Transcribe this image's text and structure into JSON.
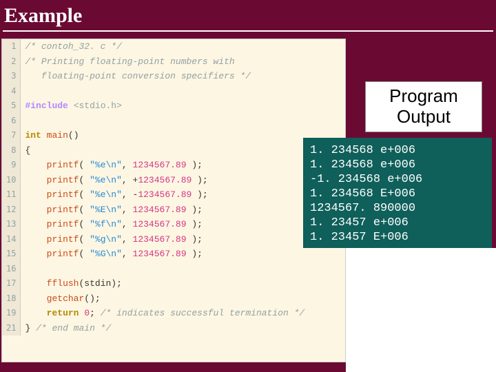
{
  "title": "Example",
  "code": {
    "lines": [
      {
        "n": "1",
        "html": "<span class='cmt'>/* contoh_32. c */</span>"
      },
      {
        "n": "2",
        "html": "<span class='cmt'>/* Printing floating-point numbers with</span>"
      },
      {
        "n": "3",
        "html": "   <span class='cmt'>floating-point conversion specifiers */</span>"
      },
      {
        "n": "4",
        "html": ""
      },
      {
        "n": "5",
        "html": "<span class='pp'>#include</span> <span class='op'>&lt;stdio.h&gt;</span>"
      },
      {
        "n": "6",
        "html": ""
      },
      {
        "n": "7",
        "html": "<span class='kw'>int</span> <span class='fn'>main</span>()"
      },
      {
        "n": "8",
        "html": "{"
      },
      {
        "n": "9",
        "html": "    <span class='fn'>printf</span>( <span class='str'>\"%e\\n\"</span>, <span class='num'>1234567.89</span> );"
      },
      {
        "n": "10",
        "html": "    <span class='fn'>printf</span>( <span class='str'>\"%e\\n\"</span>, +<span class='num'>1234567.89</span> );"
      },
      {
        "n": "11",
        "html": "    <span class='fn'>printf</span>( <span class='str'>\"%e\\n\"</span>, -<span class='num'>1234567.89</span> );"
      },
      {
        "n": "12",
        "html": "    <span class='fn'>printf</span>( <span class='str'>\"%E\\n\"</span>, <span class='num'>1234567.89</span> );"
      },
      {
        "n": "13",
        "html": "    <span class='fn'>printf</span>( <span class='str'>\"%f\\n\"</span>, <span class='num'>1234567.89</span> );"
      },
      {
        "n": "14",
        "html": "    <span class='fn'>printf</span>( <span class='str'>\"%g\\n\"</span>, <span class='num'>1234567.89</span> );"
      },
      {
        "n": "15",
        "html": "    <span class='fn'>printf</span>( <span class='str'>\"%G\\n\"</span>, <span class='num'>1234567.89</span> );"
      },
      {
        "n": "16",
        "html": ""
      },
      {
        "n": "17",
        "html": "    <span class='fn'>fflush</span>(stdin);"
      },
      {
        "n": "18",
        "html": "    <span class='fn'>getchar</span>();"
      },
      {
        "n": "19",
        "html": "    <span class='kw'>return</span> <span class='num'>0</span>; <span class='cmt'>/* indicates successful termination */</span>"
      },
      {
        "n": "21",
        "html": "} <span class='cmt'>/* end main */</span>"
      }
    ]
  },
  "output_title": "Program Output",
  "output_lines": [
    "1. 234568 e+006",
    "1. 234568 e+006",
    "-1. 234568 e+006",
    "1. 234568 E+006",
    "1234567. 890000",
    "1. 23457 e+006",
    "1. 23457 E+006"
  ]
}
